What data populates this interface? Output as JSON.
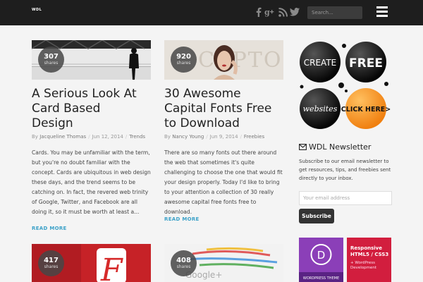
{
  "header": {
    "logo": "WDL",
    "search_placeholder": "Search...",
    "social_icons": [
      "facebook-icon",
      "google-plus-icon",
      "rss-icon",
      "twitter-icon"
    ]
  },
  "posts": [
    {
      "shares": "307",
      "shares_label": "shares",
      "title": "A Serious Look At Card Based Design",
      "by": "By",
      "author": "Jacqueline Thomas",
      "date": "Jun 12, 2014",
      "category": "Trends",
      "excerpt": "Cards. You may be unfamiliar with the term, but you're no doubt familiar with the concept. Cards are ubiquitous in web design these days, and the trend seems to be catching on. In fact, the revered web trinity of Google, Twitter, and Facebook are all doing it, so it must be worth at least a...",
      "read_more": "READ MORE"
    },
    {
      "shares": "920",
      "shares_label": "shares",
      "title": "30 Awesome Capital Fonts Free to Download",
      "by": "By",
      "author": "Nancy Young",
      "date": "Jun 9, 2014",
      "category": "Freebies",
      "excerpt": "There are so many fonts out there around the web that sometimes it's quite challenging to choose the one that would fit your design properly. Today I'd like to bring to your attention a collection of 30 really awesome capital free fonts free to download.",
      "read_more": "READ MORE"
    },
    {
      "shares": "417",
      "shares_label": "shares"
    },
    {
      "shares": "408",
      "shares_label": "shares"
    }
  ],
  "sidebar": {
    "ad_words": [
      "CREATE",
      "FREE",
      "websites",
      "CLICK HERE>"
    ],
    "newsletter_title": "WDL Newsletter",
    "newsletter_desc": "Subscribe to our email newsletter to get resources, tips, and freebies sent directly to your inbox.",
    "email_placeholder": "Your email address",
    "subscribe_label": "Subscribe",
    "bottom_ad_1": "WORDPRESS THEME",
    "bottom_ad_2_title": "Responsive HTML5 / CSS3",
    "bottom_ad_2_sub": "+ WordPress Development"
  },
  "colors": {
    "topbar": "#1e1e1e",
    "accent_link": "#3ba1c8",
    "purple_ad": "#8b3fb8",
    "red_ad": "#d21e3e",
    "orange_bubble": "#f39a1e"
  }
}
